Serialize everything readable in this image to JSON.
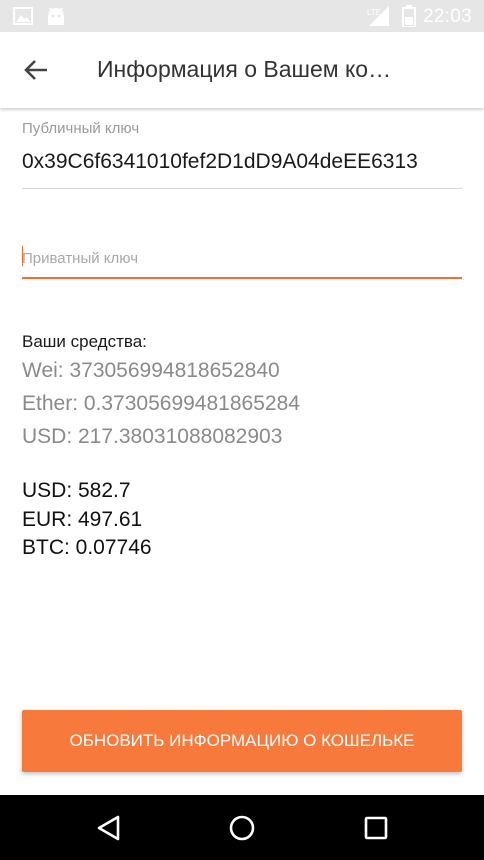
{
  "status_bar": {
    "time": "22:03",
    "network": "LTE",
    "icons": [
      "image-icon",
      "android-icon",
      "signal-icon",
      "battery-icon"
    ]
  },
  "app_bar": {
    "title": "Информация о Вашем ко…",
    "back_icon": "arrow-back-icon"
  },
  "form": {
    "public_key_label": "Публичный ключ",
    "public_key_value": "0x39C6f6341010fef2D1dD9A04deEE6313",
    "private_key_placeholder": "Приватный ключ",
    "private_key_value": ""
  },
  "funds": {
    "title": "Ваши средства:",
    "wei": "Wei: 373056994818652840",
    "ether": "Ether: 0.37305699481865284",
    "usd": "USD: 217.38031088082903"
  },
  "rates": {
    "usd": "USD: 582.7",
    "eur": "EUR: 497.61",
    "btc": "BTC: 0.07746"
  },
  "refresh_button": {
    "label": "ОБНОВИТЬ ИНФОРМАЦИЮ О КОШЕЛЬКЕ"
  },
  "nav_bar": {
    "back": "nav-back-icon",
    "home": "nav-home-icon",
    "recents": "nav-recents-icon"
  },
  "colors": {
    "accent": "#f77a3c",
    "underline_active": "#f36f2f",
    "status_bar": "#e6e6e6",
    "nav_bar": "#000000"
  }
}
